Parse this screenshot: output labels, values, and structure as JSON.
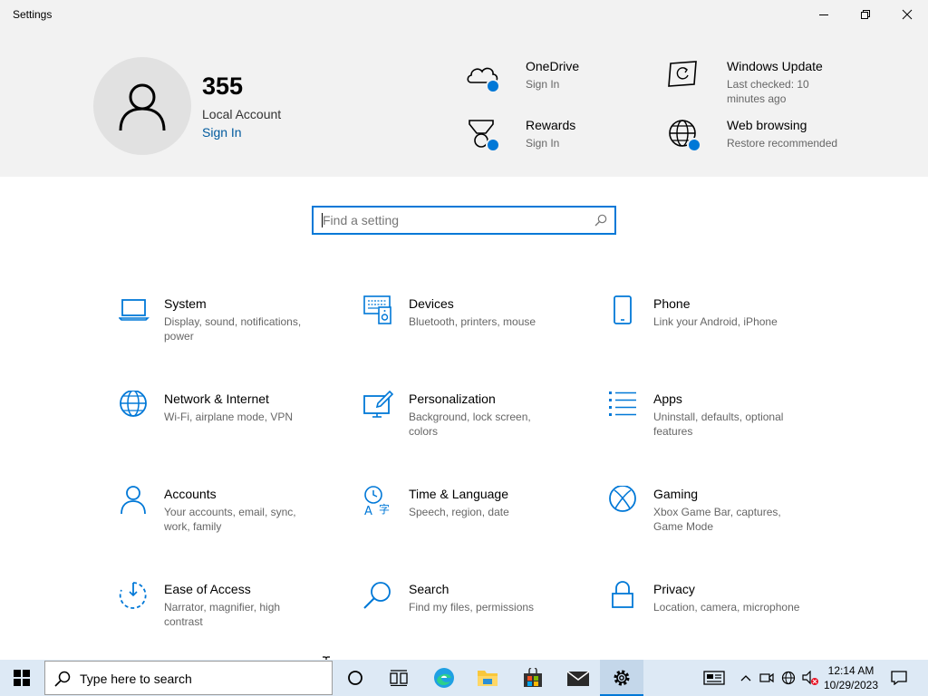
{
  "window": {
    "title": "Settings"
  },
  "account": {
    "name": "355",
    "type": "Local Account",
    "signin": "Sign In"
  },
  "header_items": [
    {
      "icon": "onedrive-icon",
      "title": "OneDrive",
      "subtitle": "Sign In"
    },
    {
      "icon": "windows-update-icon",
      "title": "Windows Update",
      "subtitle": "Last checked: 10 minutes ago"
    },
    {
      "icon": "rewards-icon",
      "title": "Rewards",
      "subtitle": "Sign In"
    },
    {
      "icon": "web-browsing-icon",
      "title": "Web browsing",
      "subtitle": "Restore recommended"
    }
  ],
  "search": {
    "placeholder": "Find a setting"
  },
  "categories": [
    {
      "icon": "laptop-icon",
      "title": "System",
      "subtitle": "Display, sound, notifications, power"
    },
    {
      "icon": "devices-icon",
      "title": "Devices",
      "subtitle": "Bluetooth, printers, mouse"
    },
    {
      "icon": "phone-icon",
      "title": "Phone",
      "subtitle": "Link your Android, iPhone"
    },
    {
      "icon": "globe-icon",
      "title": "Network & Internet",
      "subtitle": "Wi-Fi, airplane mode, VPN"
    },
    {
      "icon": "personalization-icon",
      "title": "Personalization",
      "subtitle": "Background, lock screen, colors"
    },
    {
      "icon": "apps-icon",
      "title": "Apps",
      "subtitle": "Uninstall, defaults, optional features"
    },
    {
      "icon": "person-icon",
      "title": "Accounts",
      "subtitle": "Your accounts, email, sync, work, family"
    },
    {
      "icon": "time-language-icon",
      "title": "Time & Language",
      "subtitle": "Speech, region, date"
    },
    {
      "icon": "xbox-icon",
      "title": "Gaming",
      "subtitle": "Xbox Game Bar, captures, Game Mode"
    },
    {
      "icon": "ease-of-access-icon",
      "title": "Ease of Access",
      "subtitle": "Narrator, magnifier, high contrast"
    },
    {
      "icon": "search-icon",
      "title": "Search",
      "subtitle": "Find my files, permissions"
    },
    {
      "icon": "lock-icon",
      "title": "Privacy",
      "subtitle": "Location, camera, microphone"
    }
  ],
  "taskbar": {
    "search_text": "Type here to search",
    "time": "12:14 AM",
    "date": "10/29/2023"
  },
  "colors": {
    "accent": "#0078d7",
    "header_bg": "#f2f2f2",
    "taskbar_bg": "#dde9f5"
  }
}
